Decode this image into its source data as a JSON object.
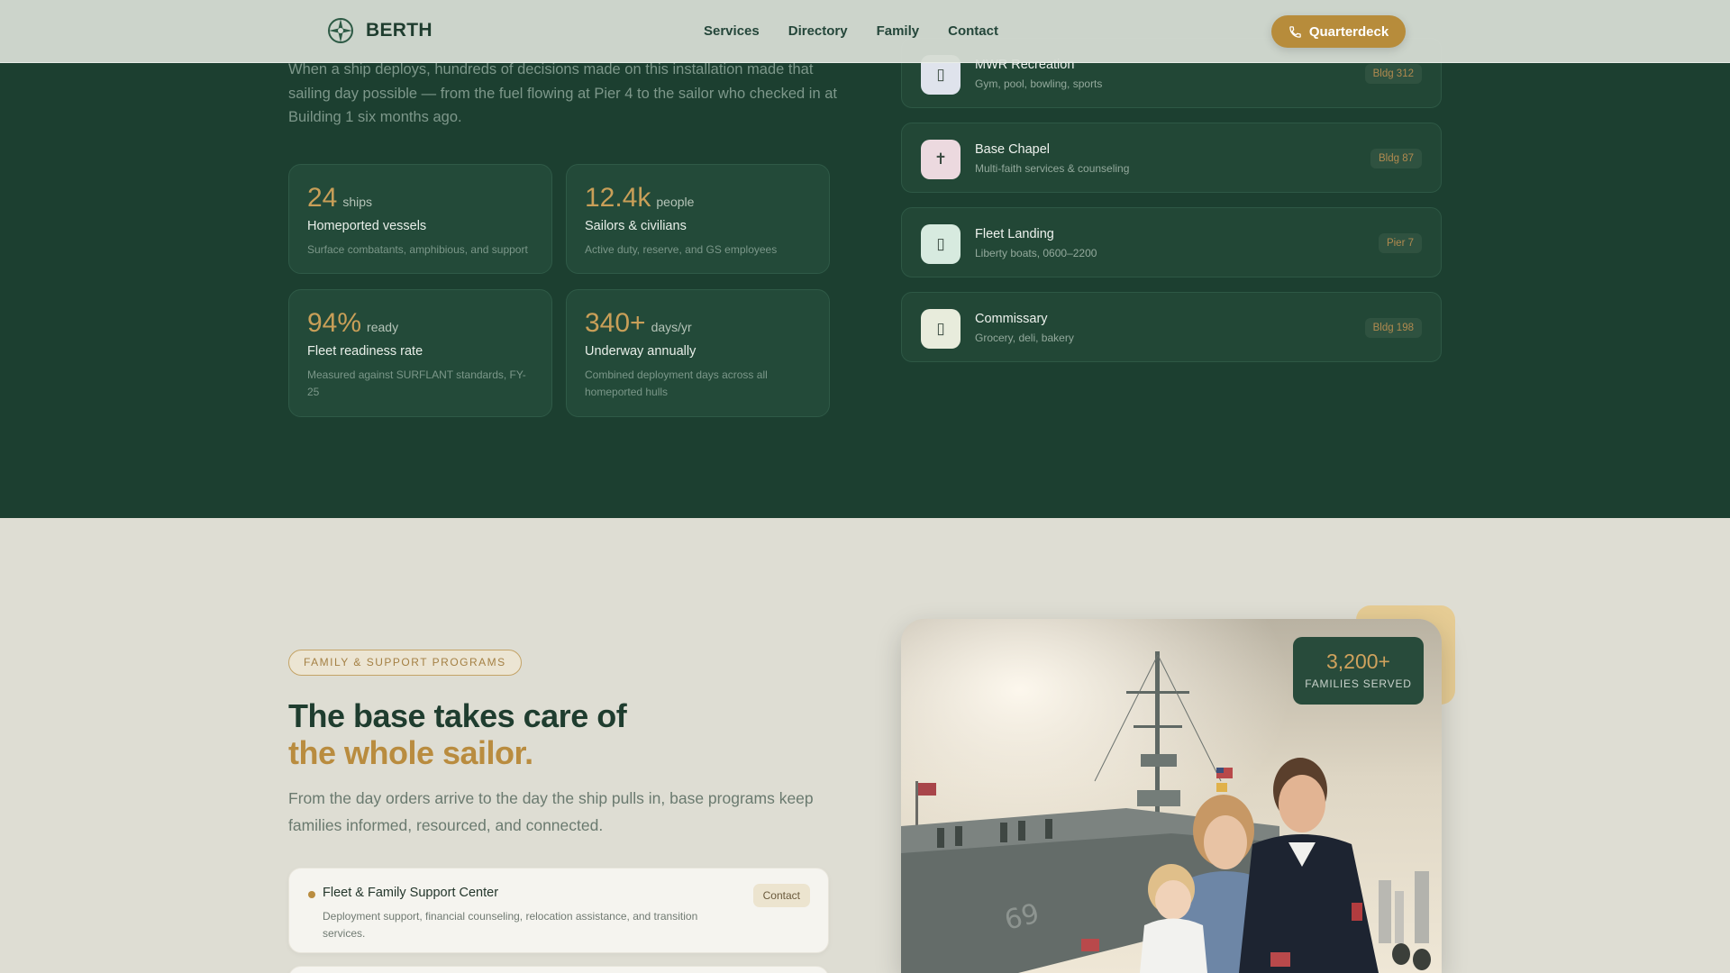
{
  "header": {
    "brand": "BERTH",
    "nav": [
      "Services",
      "Directory",
      "Family",
      "Contact"
    ],
    "cta_label": "Quarterdeck"
  },
  "about": {
    "intro": "When a ship deploys, hundreds of decisions made on this installation made that sailing day possible — from the fuel flowing at Pier 4 to the sailor who checked in at Building 1 six months ago.",
    "stats": [
      {
        "value": "24",
        "unit": "ships",
        "title": "Homeported vessels",
        "desc": "Surface combatants, amphibious, and support"
      },
      {
        "value": "12.4k",
        "unit": "people",
        "title": "Sailors & civilians",
        "desc": "Active duty, reserve, and GS employees"
      },
      {
        "value": "94%",
        "unit": "ready",
        "title": "Fleet readiness rate",
        "desc": "Measured against SURFLANT standards, FY-25"
      },
      {
        "value": "340+",
        "unit": "days/yr",
        "title": "Underway annually",
        "desc": "Combined deployment days across all homeported hulls"
      }
    ]
  },
  "directory": {
    "items": [
      {
        "name": "MWR Recreation",
        "sub": "Gym, pool, bowling, sports",
        "tag": "Bldg 312",
        "icon": "recreation-icon",
        "icon_bg": "#dfe3ec",
        "glyph": "▯"
      },
      {
        "name": "Base Chapel",
        "sub": "Multi-faith services & counseling",
        "tag": "Bldg 87",
        "icon": "cross-icon",
        "icon_bg": "#ecd9df",
        "glyph": "✝"
      },
      {
        "name": "Fleet Landing",
        "sub": "Liberty boats, 0600–2200",
        "tag": "Pier 7",
        "icon": "boat-icon",
        "icon_bg": "#d7eadf",
        "glyph": "▯"
      },
      {
        "name": "Commissary",
        "sub": "Grocery, deli, bakery",
        "tag": "Bldg 198",
        "icon": "grocery-icon",
        "icon_bg": "#e8ecdc",
        "glyph": "▯"
      }
    ]
  },
  "family": {
    "eyebrow": "FAMILY & SUPPORT PROGRAMS",
    "heading_line1": "The base takes care of",
    "heading_line2": "the whole sailor.",
    "lead": "From the day orders arrive to the day the ship pulls in, base programs keep families informed, resourced, and connected.",
    "programs": [
      {
        "name": "Fleet & Family Support Center",
        "desc": "Deployment support, financial counseling, relocation assistance, and transition services.",
        "action": "Contact"
      }
    ],
    "badge_value": "3,200+",
    "badge_label": "FAMILIES SERVED"
  },
  "colors": {
    "dark_green": "#1c3f30",
    "gold": "#b78c3b",
    "cream": "#deddd3"
  }
}
